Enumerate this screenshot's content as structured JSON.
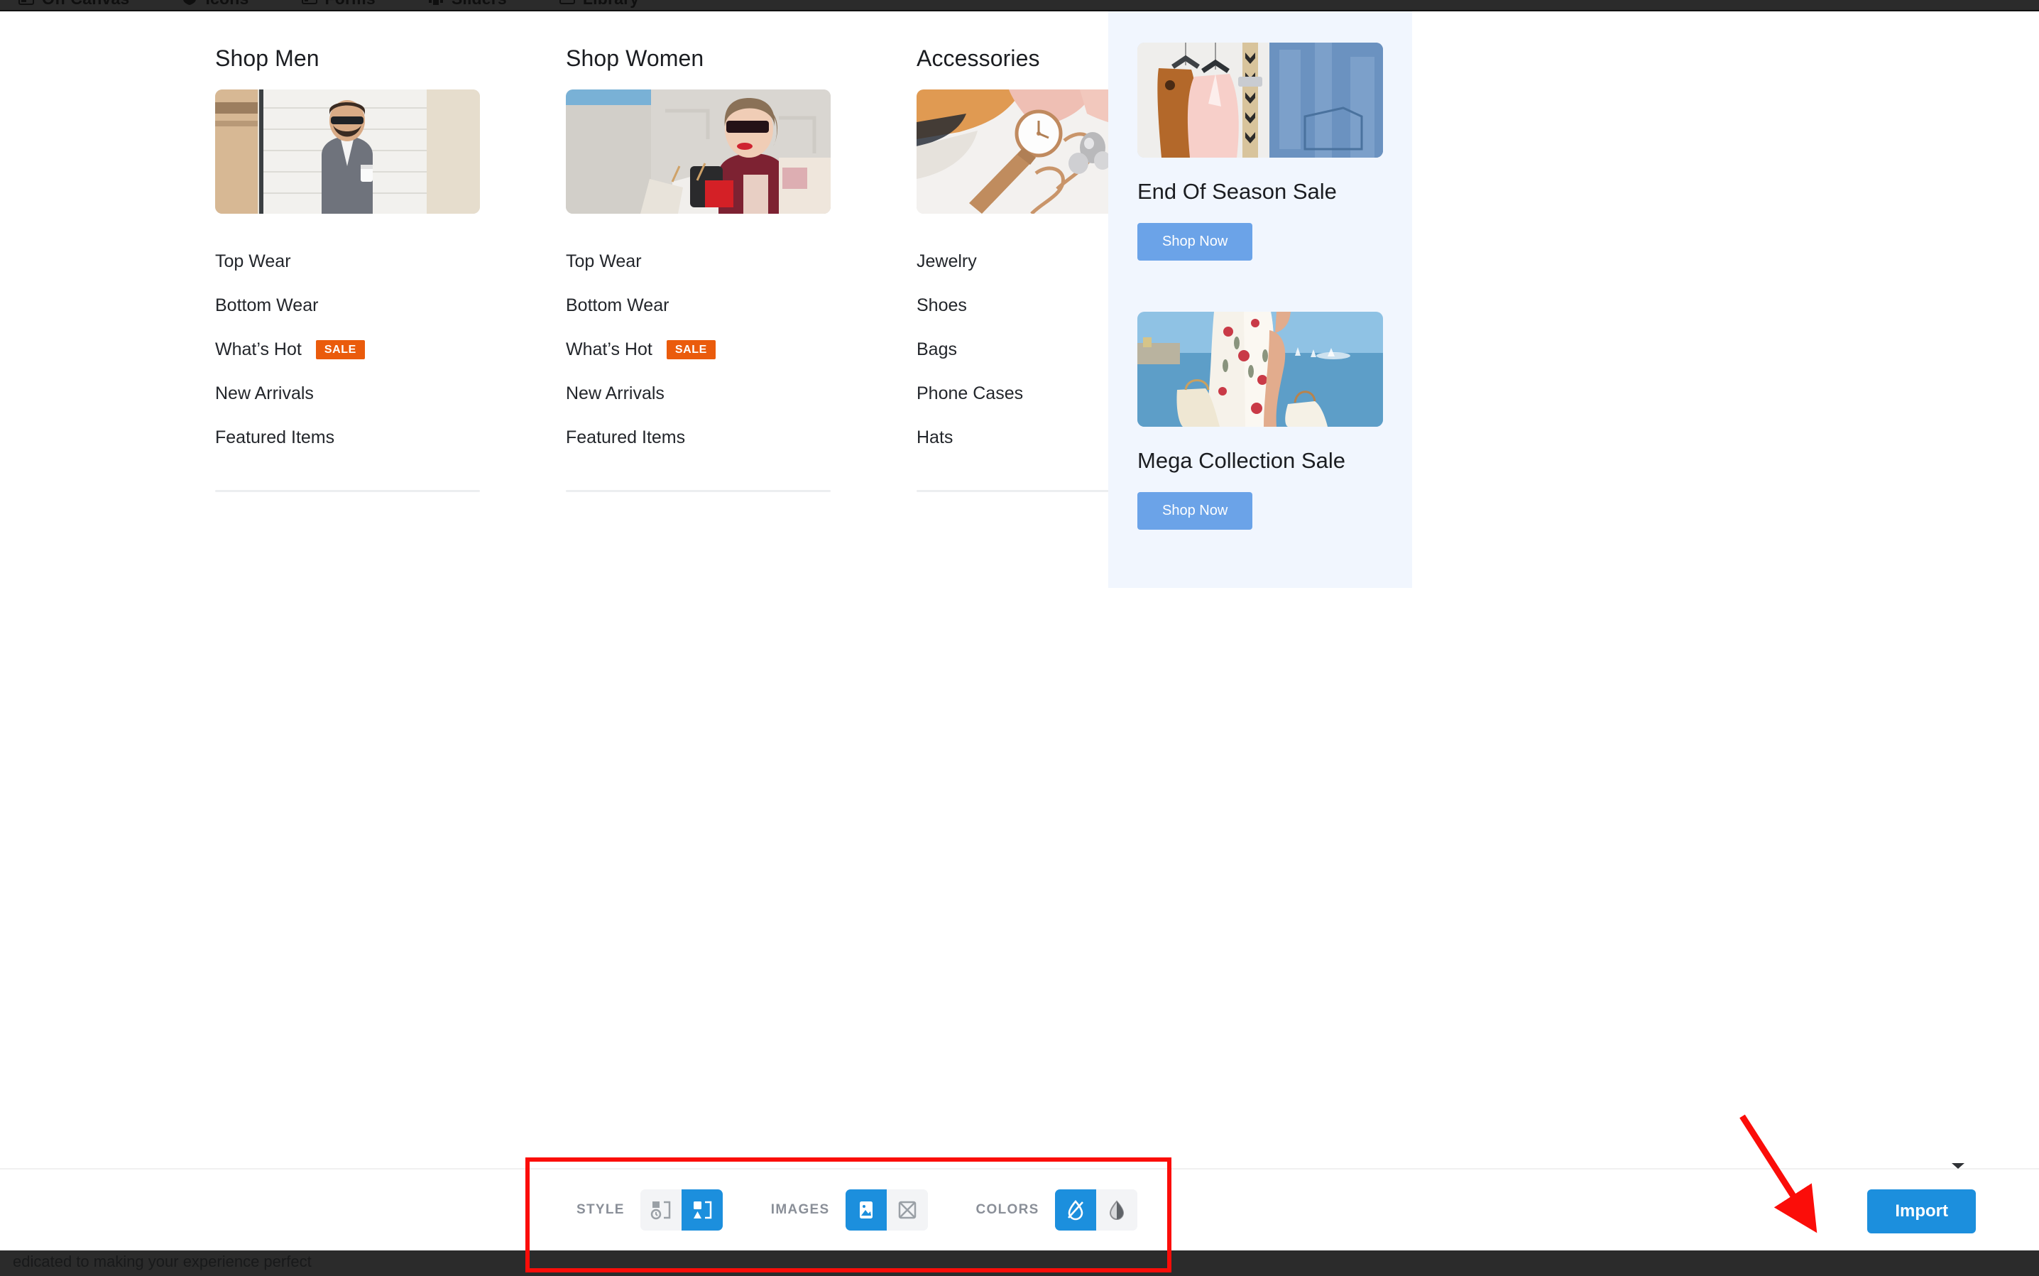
{
  "topbar": {
    "items": [
      {
        "label": "Off Canvas",
        "icon": "offcanvas-icon"
      },
      {
        "label": "Icons",
        "icon": "shield-icon"
      },
      {
        "label": "Forms",
        "icon": "form-icon"
      },
      {
        "label": "Sliders",
        "icon": "slider-icon"
      },
      {
        "label": "Library",
        "icon": "library-icon"
      }
    ]
  },
  "mega_menu": {
    "columns": [
      {
        "title": "Shop Men",
        "image_alt": "man-in-suit-with-coffee",
        "links": [
          {
            "label": "Top Wear",
            "badge": ""
          },
          {
            "label": "Bottom Wear",
            "badge": ""
          },
          {
            "label": "What’s Hot",
            "badge": "SALE"
          },
          {
            "label": "New Arrivals",
            "badge": ""
          },
          {
            "label": "Featured Items",
            "badge": ""
          }
        ]
      },
      {
        "title": "Shop Women",
        "image_alt": "woman-with-sunglasses-shopping-bags",
        "links": [
          {
            "label": "Top Wear",
            "badge": ""
          },
          {
            "label": "Bottom Wear",
            "badge": ""
          },
          {
            "label": "What’s Hot",
            "badge": "SALE"
          },
          {
            "label": "New Arrivals",
            "badge": ""
          },
          {
            "label": "Featured Items",
            "badge": ""
          }
        ]
      },
      {
        "title": "Accessories",
        "image_alt": "watch-jewelry-scarves-flatlay",
        "links": [
          {
            "label": "Jewelry",
            "badge": ""
          },
          {
            "label": "Shoes",
            "badge": ""
          },
          {
            "label": "Bags",
            "badge": ""
          },
          {
            "label": "Phone Cases",
            "badge": ""
          },
          {
            "label": "Hats",
            "badge": ""
          }
        ]
      }
    ]
  },
  "promo": {
    "cards": [
      {
        "title": "End Of Season Sale",
        "button": "Shop Now",
        "image_alt": "clothes-on-hangers-jacket-jeans"
      },
      {
        "title": "Mega Collection Sale",
        "button": "Shop Now",
        "image_alt": "woman-in-floral-dress-by-the-sea"
      }
    ]
  },
  "bottom_toolbar": {
    "groups": [
      {
        "label": "STYLE",
        "options": [
          {
            "icon": "layout-clock-icon",
            "active": false
          },
          {
            "icon": "layout-split-icon",
            "active": true
          }
        ]
      },
      {
        "label": "IMAGES",
        "options": [
          {
            "icon": "image-icon",
            "active": true
          },
          {
            "icon": "image-placeholder-icon",
            "active": false
          }
        ]
      },
      {
        "label": "COLORS",
        "options": [
          {
            "icon": "droplet-off-icon",
            "active": true
          },
          {
            "icon": "droplet-half-icon",
            "active": false
          }
        ]
      }
    ],
    "import_label": "Import"
  },
  "footer_strip": {
    "text_left": "edicated to making your experience perfect",
    "text_center": ""
  },
  "colors": {
    "accent_blue": "#1c8fdd",
    "promo_blue": "#6ba3e8",
    "promo_bg": "#f1f6fe",
    "sale_orange": "#ea5b0c",
    "annotation_red": "#fb0d09",
    "toolbar_dark": "#2b2b2b"
  }
}
